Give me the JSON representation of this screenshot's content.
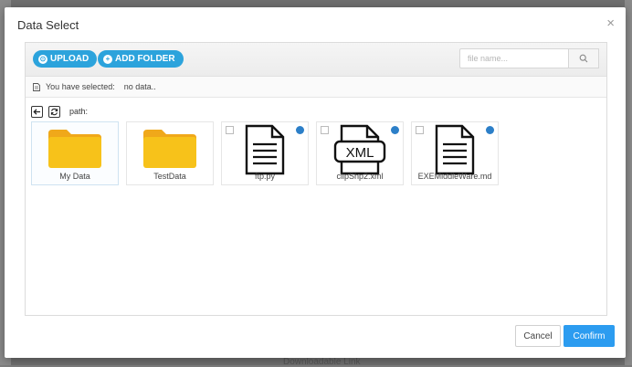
{
  "background": {
    "bottom_text": "Downloadable Link"
  },
  "modal": {
    "title": "Data Select",
    "close_glyph": "×"
  },
  "toolbar": {
    "upload_label": "UPLOAD",
    "add_folder_label": "ADD FOLDER",
    "search_placeholder": "file name...",
    "search_icon": "search-icon"
  },
  "selection": {
    "label": "You have selected:",
    "value": "no data.."
  },
  "path": {
    "label": "path:",
    "back_icon": "arrow-left-icon",
    "refresh_icon": "refresh-icon"
  },
  "items": [
    {
      "name": "My Data",
      "type": "folder",
      "has_checkbox": false,
      "has_owner_badge": false
    },
    {
      "name": "TestData",
      "type": "folder",
      "has_checkbox": false,
      "has_owner_badge": false
    },
    {
      "name": "ftp.py",
      "type": "file",
      "has_checkbox": true,
      "has_owner_badge": true
    },
    {
      "name": "clipShp2.xml",
      "type": "xml",
      "has_checkbox": true,
      "has_owner_badge": true
    },
    {
      "name": "EXEMiddleWare.md",
      "type": "file",
      "has_checkbox": true,
      "has_owner_badge": true
    }
  ],
  "footer": {
    "cancel_label": "Cancel",
    "confirm_label": "Confirm"
  },
  "colors": {
    "accent": "#2ca3dc",
    "confirm": "#2c9cf0",
    "folder": "#f7c21a",
    "owner_badge": "#2c7fc8"
  }
}
